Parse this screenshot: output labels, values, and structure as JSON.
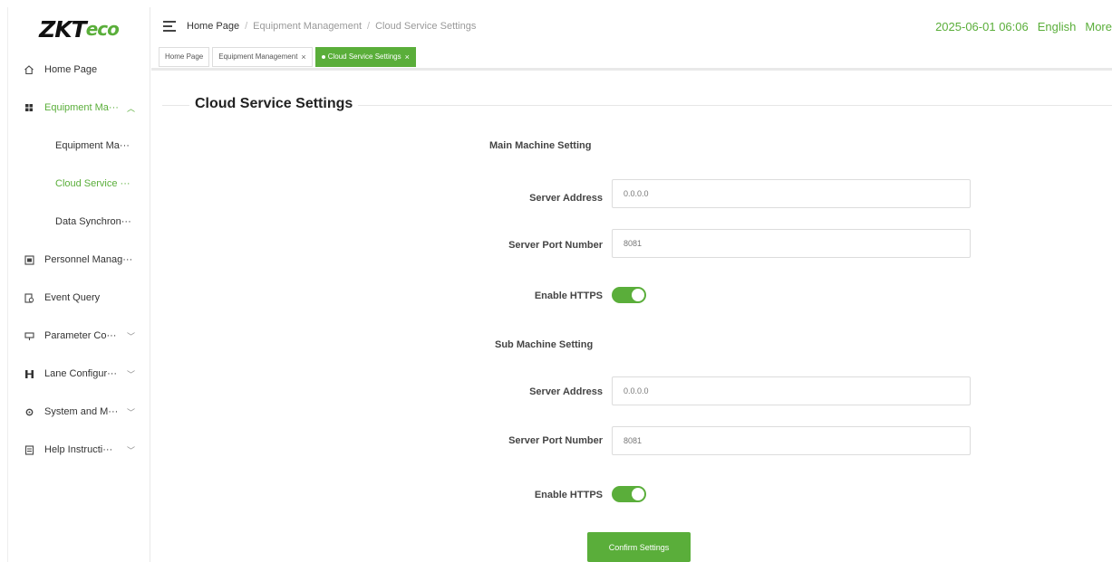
{
  "brand": {
    "logo_main": "ZKT",
    "logo_accent": "eco"
  },
  "sidebar": {
    "items": [
      {
        "label": "Home Page",
        "icon": "home-icon"
      },
      {
        "label": "Equipment Ma···",
        "icon": "equipment-icon",
        "expanded": true
      },
      {
        "label": "Personnel Manag···",
        "icon": "personnel-icon"
      },
      {
        "label": "Event Query",
        "icon": "event-icon"
      },
      {
        "label": "Parameter Co···",
        "icon": "parameter-icon"
      },
      {
        "label": "Lane Configur···",
        "icon": "lane-icon"
      },
      {
        "label": "System and M···",
        "icon": "system-icon"
      },
      {
        "label": "Help Instructi···",
        "icon": "help-icon"
      }
    ],
    "sub_items": [
      {
        "label": "Equipment Ma···"
      },
      {
        "label": "Cloud Service ···",
        "active": true
      },
      {
        "label": "Data Synchron···"
      }
    ]
  },
  "header": {
    "breadcrumb": [
      "Home Page",
      "Equipment Management",
      "Cloud Service Settings"
    ],
    "datetime": "2025-06-01 06:06",
    "language": "English",
    "more": "More"
  },
  "tabs": [
    {
      "label": "Home Page"
    },
    {
      "label": "Equipment Management",
      "close": "×"
    },
    {
      "label": "Cloud Service Settings",
      "close": "×",
      "active": true
    }
  ],
  "page": {
    "title": "Cloud Service Settings",
    "main": {
      "title": "Main Machine Setting",
      "server_address_label": "Server Address",
      "server_address_value": "0.0.0.0",
      "server_port_label": "Server Port Number",
      "server_port_value": "8081",
      "https_label": "Enable HTTPS",
      "https_enabled": true
    },
    "sub": {
      "title": "Sub Machine Setting",
      "server_address_label": "Server Address",
      "server_address_value": "0.0.0.0",
      "server_port_label": "Server Port Number",
      "server_port_value": "8081",
      "https_label": "Enable HTTPS",
      "https_enabled": true
    },
    "confirm_label": "Confirm Settings"
  },
  "colors": {
    "accent": "#5aae3a",
    "border": "#dcdcdc"
  }
}
